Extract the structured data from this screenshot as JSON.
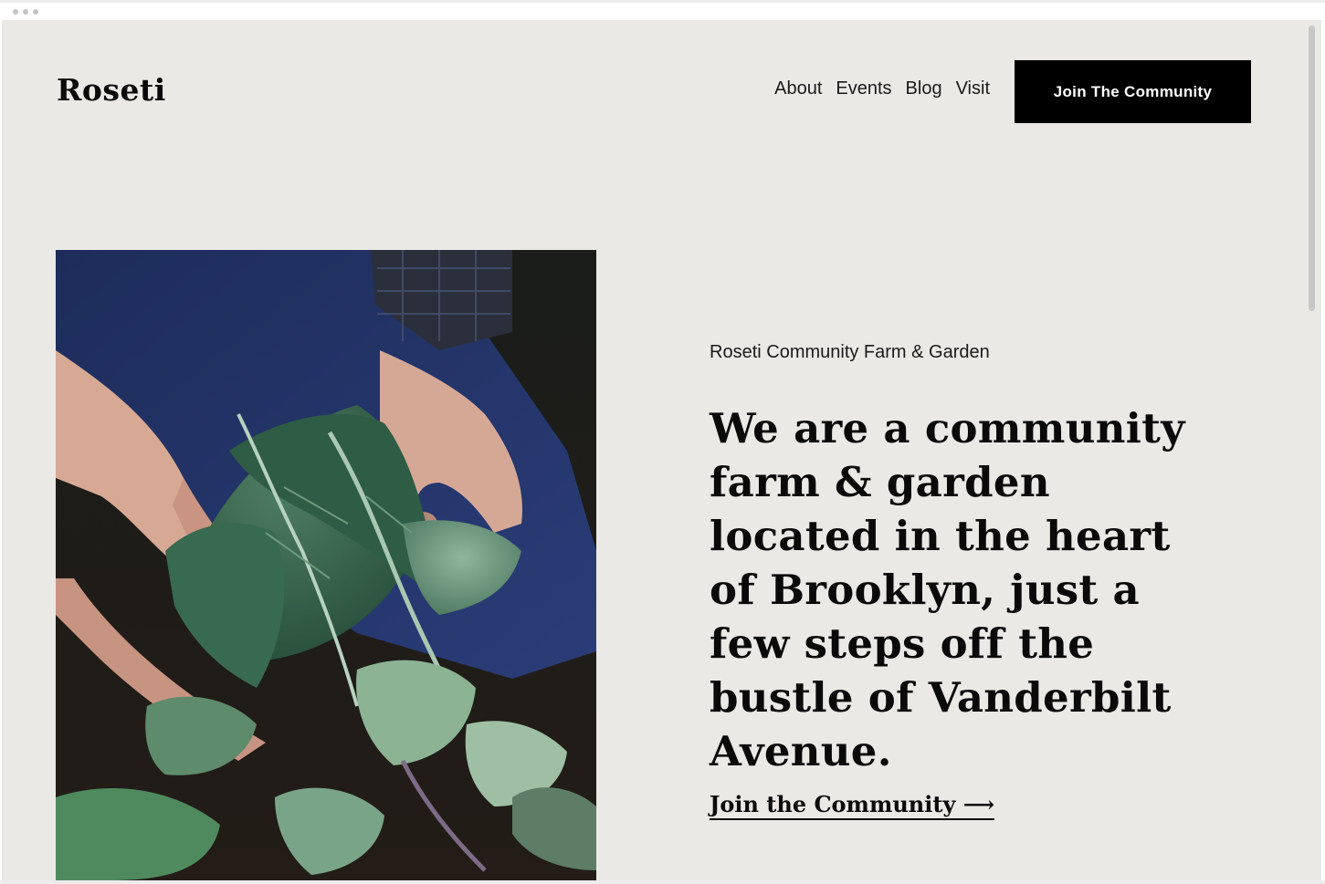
{
  "site": {
    "logo": "Roseti"
  },
  "nav": {
    "items": [
      {
        "label": "About"
      },
      {
        "label": "Events"
      },
      {
        "label": "Blog"
      },
      {
        "label": "Visit"
      }
    ],
    "cta_label": "Join The Community"
  },
  "hero": {
    "image_alt": "hands holding leafy green seedlings in a garden bed",
    "eyebrow": "Roseti Community Farm & Garden",
    "headline": "We are a community farm & garden located in the heart of Brooklyn, just a few steps off the bustle of Vanderbilt Avenue.",
    "link_label": "Join the Community ⟶"
  },
  "colors": {
    "background": "#ebe9e6",
    "text": "#0a0a0a",
    "button": "#000000",
    "button_text": "#ffffff"
  }
}
